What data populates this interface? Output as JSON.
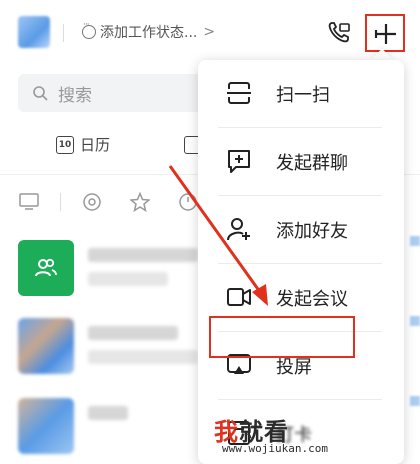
{
  "header": {
    "status_label": "添加工作状态...",
    "status_chevron": ">"
  },
  "search": {
    "placeholder": "搜索"
  },
  "tabs": {
    "calendar_day": "10",
    "calendar_label": "日历"
  },
  "menu": {
    "items": [
      {
        "label": "扫一扫",
        "icon": "scan-icon"
      },
      {
        "label": "发起群聊",
        "icon": "group-chat-icon"
      },
      {
        "label": "添加好友",
        "icon": "add-friend-icon"
      },
      {
        "label": "发起会议",
        "icon": "meeting-icon"
      },
      {
        "label": "投屏",
        "icon": "screen-cast-icon",
        "highlighted": true
      },
      {
        "label": "打卡",
        "icon": "clock-in-icon"
      }
    ]
  },
  "watermark": {
    "brand_red": "我",
    "brand_dark": "就看",
    "url": "www.wojiukan.com"
  },
  "colors": {
    "highlight": "#e0301e",
    "green_avatar": "#1dac58"
  }
}
